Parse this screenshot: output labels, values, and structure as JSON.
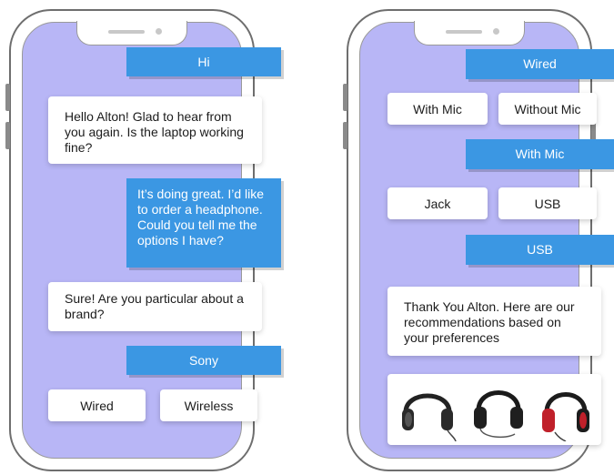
{
  "left_chat": {
    "messages": [
      {
        "role": "user",
        "text": "Hi"
      },
      {
        "role": "bot",
        "text": "Hello Alton! Glad to hear from you again. Is the laptop working fine?"
      },
      {
        "role": "user",
        "text": "It’s doing great. I’d like to order a headphone. Could you tell me the options I have?"
      },
      {
        "role": "bot",
        "text": "Sure! Are you particular about a brand?"
      },
      {
        "role": "user",
        "text": "Sony"
      }
    ],
    "options": [
      "Wired",
      "Wireless"
    ]
  },
  "right_chat": {
    "selected_1": "Wired",
    "options_1": [
      "With Mic",
      "Without Mic"
    ],
    "selected_2": "With Mic",
    "options_2": [
      "Jack",
      "USB"
    ],
    "selected_3": "USB",
    "recommendation_text": "Thank You Alton. Here are our recommendations based on your preferences",
    "products": [
      {
        "icon": "headphone-icon",
        "color": "#222222"
      },
      {
        "icon": "headphone-icon",
        "color": "#1a1a1a"
      },
      {
        "icon": "headphone-icon",
        "color": "#c0202a"
      }
    ]
  }
}
